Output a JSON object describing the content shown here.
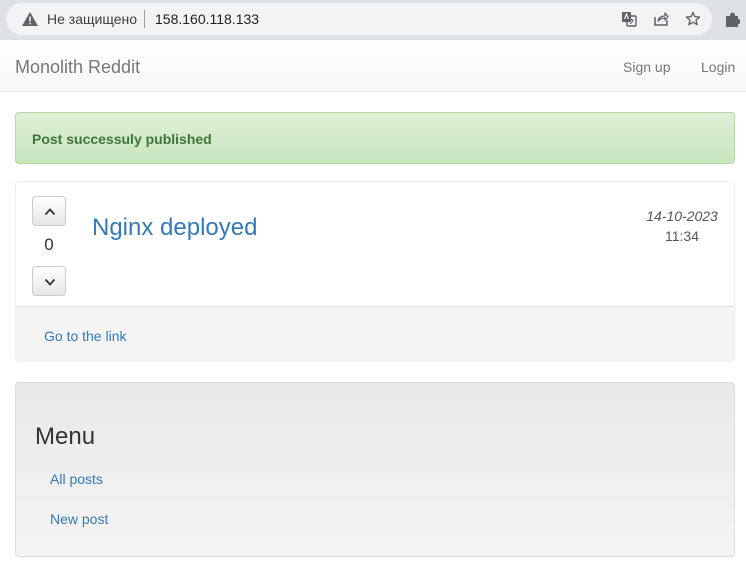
{
  "browser": {
    "security_label": "Не защищено",
    "url": "158.160.118.133",
    "icons": [
      "warning-icon",
      "translate-icon",
      "share-icon",
      "star-icon",
      "extensions-icon"
    ]
  },
  "navbar": {
    "brand": "Monolith Reddit",
    "links": [
      "Sign up",
      "Login"
    ]
  },
  "alert": {
    "message": "Post successuly published",
    "color": "#3c763d"
  },
  "post": {
    "votes": "0",
    "title": "Nginx deployed",
    "date": "14-10-2023",
    "time": "11:34",
    "link_label": "Go to the link"
  },
  "menu": {
    "title": "Menu",
    "items": [
      "All posts",
      "New post"
    ]
  },
  "colors": {
    "link": "#337ab7",
    "alert_bg": "#dff0d8"
  }
}
